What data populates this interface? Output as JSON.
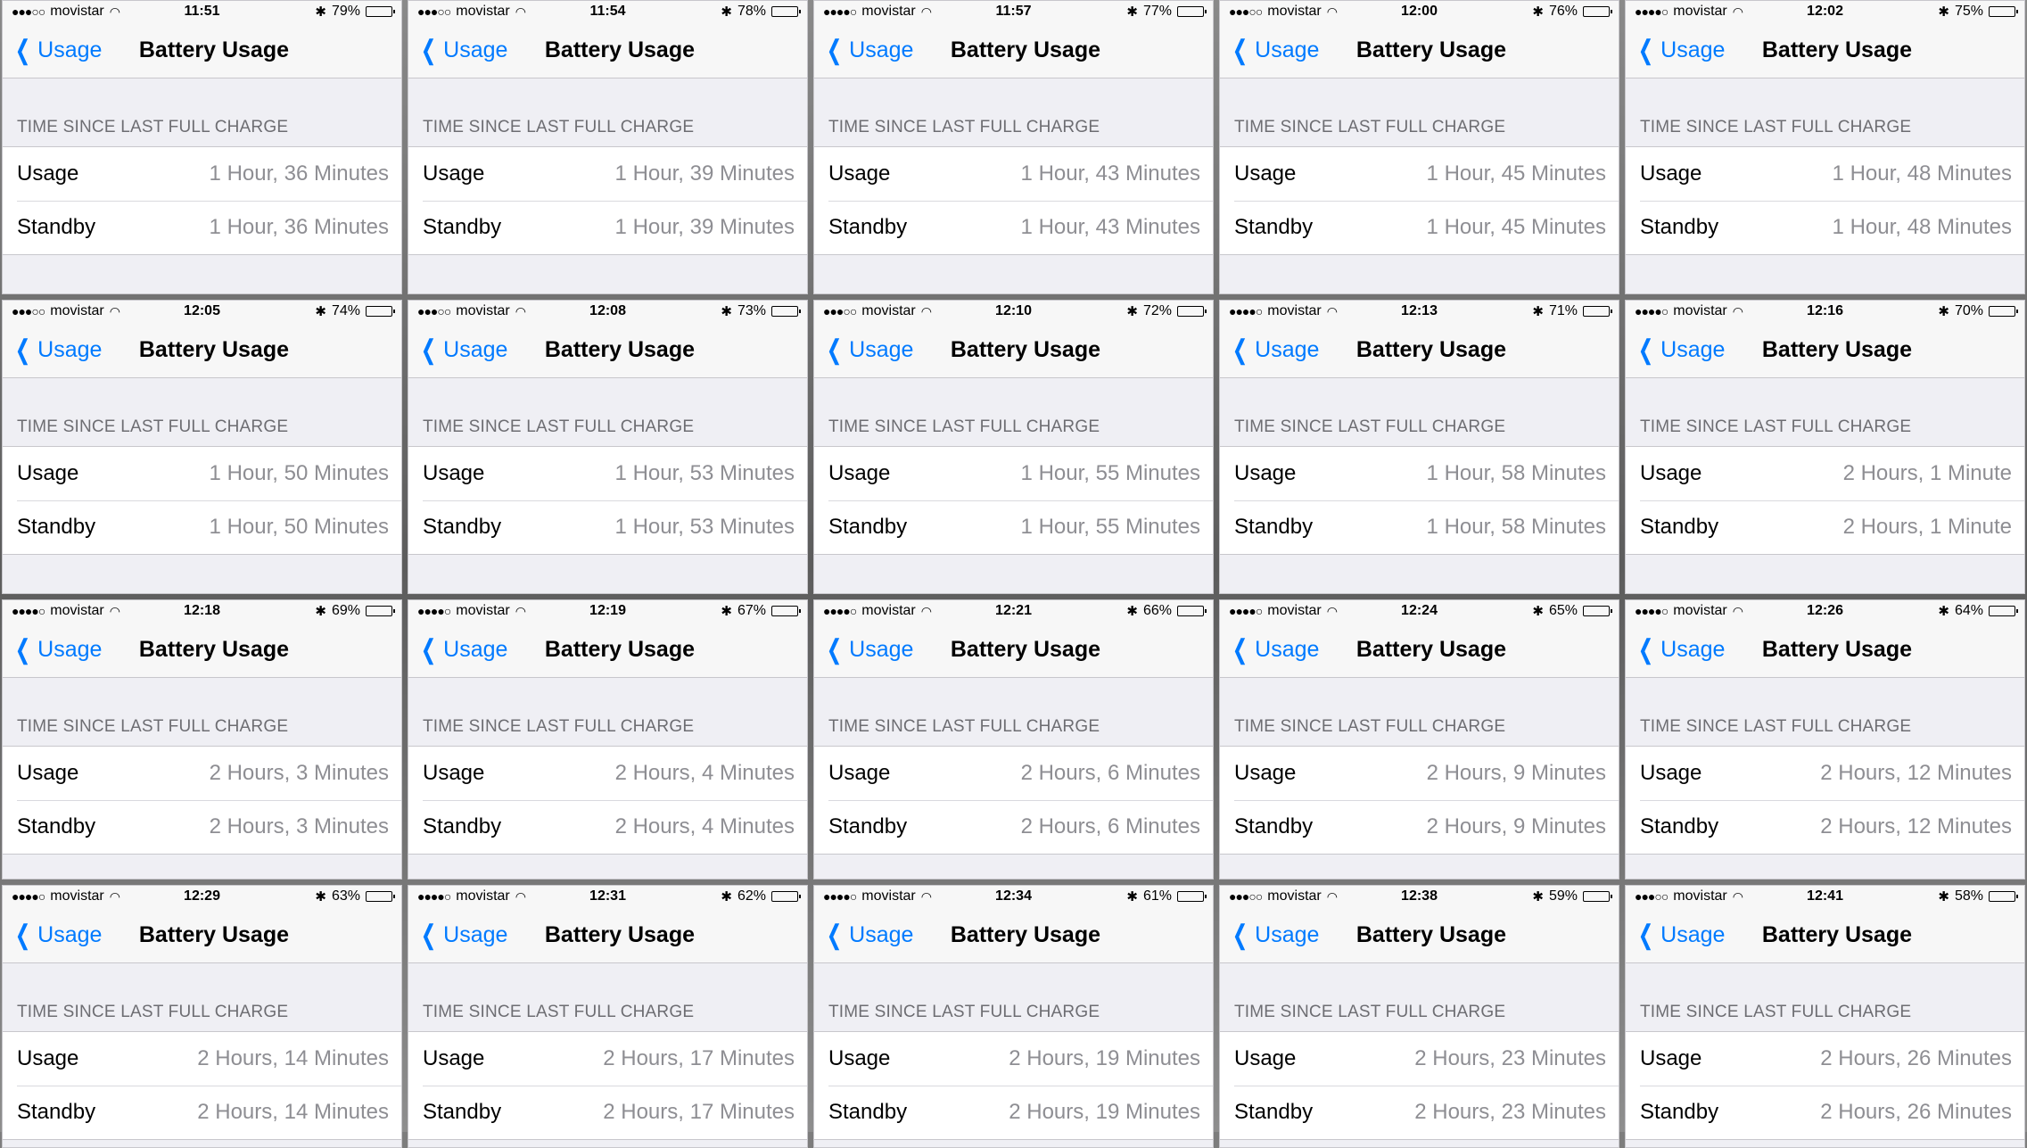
{
  "screens": [
    {
      "carrier": "movistar",
      "signal": "●●●○○",
      "time": "11:51",
      "battery_pct": "79%",
      "battery_level": 0.79,
      "back_label": "Usage",
      "title": "Battery Usage",
      "section_header": "TIME SINCE LAST FULL CHARGE",
      "usage_label": "Usage",
      "usage_value": "1 Hour, 36 Minutes",
      "standby_label": "Standby",
      "standby_value": "1 Hour, 36 Minutes"
    },
    {
      "carrier": "movistar",
      "signal": "●●●○○",
      "time": "11:54",
      "battery_pct": "78%",
      "battery_level": 0.78,
      "back_label": "Usage",
      "title": "Battery Usage",
      "section_header": "TIME SINCE LAST FULL CHARGE",
      "usage_label": "Usage",
      "usage_value": "1 Hour, 39 Minutes",
      "standby_label": "Standby",
      "standby_value": "1 Hour, 39 Minutes"
    },
    {
      "carrier": "movistar",
      "signal": "●●●●○",
      "time": "11:57",
      "battery_pct": "77%",
      "battery_level": 0.77,
      "back_label": "Usage",
      "title": "Battery Usage",
      "section_header": "TIME SINCE LAST FULL CHARGE",
      "usage_label": "Usage",
      "usage_value": "1 Hour, 43 Minutes",
      "standby_label": "Standby",
      "standby_value": "1 Hour, 43 Minutes"
    },
    {
      "carrier": "movistar",
      "signal": "●●●○○",
      "time": "12:00",
      "battery_pct": "76%",
      "battery_level": 0.76,
      "back_label": "Usage",
      "title": "Battery Usage",
      "section_header": "TIME SINCE LAST FULL CHARGE",
      "usage_label": "Usage",
      "usage_value": "1 Hour, 45 Minutes",
      "standby_label": "Standby",
      "standby_value": "1 Hour, 45 Minutes"
    },
    {
      "carrier": "movistar",
      "signal": "●●●●○",
      "time": "12:02",
      "battery_pct": "75%",
      "battery_level": 0.75,
      "back_label": "Usage",
      "title": "Battery Usage",
      "section_header": "TIME SINCE LAST FULL CHARGE",
      "usage_label": "Usage",
      "usage_value": "1 Hour, 48 Minutes",
      "standby_label": "Standby",
      "standby_value": "1 Hour, 48 Minutes"
    },
    {
      "carrier": "movistar",
      "signal": "●●●○○",
      "time": "12:05",
      "battery_pct": "74%",
      "battery_level": 0.74,
      "back_label": "Usage",
      "title": "Battery Usage",
      "section_header": "TIME SINCE LAST FULL CHARGE",
      "usage_label": "Usage",
      "usage_value": "1 Hour, 50 Minutes",
      "standby_label": "Standby",
      "standby_value": "1 Hour, 50 Minutes"
    },
    {
      "carrier": "movistar",
      "signal": "●●●○○",
      "time": "12:08",
      "battery_pct": "73%",
      "battery_level": 0.73,
      "back_label": "Usage",
      "title": "Battery Usage",
      "section_header": "TIME SINCE LAST FULL CHARGE",
      "usage_label": "Usage",
      "usage_value": "1 Hour, 53 Minutes",
      "standby_label": "Standby",
      "standby_value": "1 Hour, 53 Minutes"
    },
    {
      "carrier": "movistar",
      "signal": "●●●○○",
      "time": "12:10",
      "battery_pct": "72%",
      "battery_level": 0.72,
      "back_label": "Usage",
      "title": "Battery Usage",
      "section_header": "TIME SINCE LAST FULL CHARGE",
      "usage_label": "Usage",
      "usage_value": "1 Hour, 55 Minutes",
      "standby_label": "Standby",
      "standby_value": "1 Hour, 55 Minutes"
    },
    {
      "carrier": "movistar",
      "signal": "●●●●○",
      "time": "12:13",
      "battery_pct": "71%",
      "battery_level": 0.71,
      "back_label": "Usage",
      "title": "Battery Usage",
      "section_header": "TIME SINCE LAST FULL CHARGE",
      "usage_label": "Usage",
      "usage_value": "1 Hour, 58 Minutes",
      "standby_label": "Standby",
      "standby_value": "1 Hour, 58 Minutes"
    },
    {
      "carrier": "movistar",
      "signal": "●●●●○",
      "time": "12:16",
      "battery_pct": "70%",
      "battery_level": 0.7,
      "back_label": "Usage",
      "title": "Battery Usage",
      "section_header": "TIME SINCE LAST FULL CHARGE",
      "usage_label": "Usage",
      "usage_value": "2 Hours, 1 Minute",
      "standby_label": "Standby",
      "standby_value": "2 Hours, 1 Minute"
    },
    {
      "carrier": "movistar",
      "signal": "●●●●○",
      "time": "12:18",
      "battery_pct": "69%",
      "battery_level": 0.69,
      "back_label": "Usage",
      "title": "Battery Usage",
      "section_header": "TIME SINCE LAST FULL CHARGE",
      "usage_label": "Usage",
      "usage_value": "2 Hours, 3 Minutes",
      "standby_label": "Standby",
      "standby_value": "2 Hours, 3 Minutes"
    },
    {
      "carrier": "movistar",
      "signal": "●●●●○",
      "time": "12:19",
      "battery_pct": "67%",
      "battery_level": 0.67,
      "back_label": "Usage",
      "title": "Battery Usage",
      "section_header": "TIME SINCE LAST FULL CHARGE",
      "usage_label": "Usage",
      "usage_value": "2 Hours, 4 Minutes",
      "standby_label": "Standby",
      "standby_value": "2 Hours, 4 Minutes"
    },
    {
      "carrier": "movistar",
      "signal": "●●●●○",
      "time": "12:21",
      "battery_pct": "66%",
      "battery_level": 0.66,
      "back_label": "Usage",
      "title": "Battery Usage",
      "section_header": "TIME SINCE LAST FULL CHARGE",
      "usage_label": "Usage",
      "usage_value": "2 Hours, 6 Minutes",
      "standby_label": "Standby",
      "standby_value": "2 Hours, 6 Minutes"
    },
    {
      "carrier": "movistar",
      "signal": "●●●●○",
      "time": "12:24",
      "battery_pct": "65%",
      "battery_level": 0.65,
      "back_label": "Usage",
      "title": "Battery Usage",
      "section_header": "TIME SINCE LAST FULL CHARGE",
      "usage_label": "Usage",
      "usage_value": "2 Hours, 9 Minutes",
      "standby_label": "Standby",
      "standby_value": "2 Hours, 9 Minutes"
    },
    {
      "carrier": "movistar",
      "signal": "●●●●○",
      "time": "12:26",
      "battery_pct": "64%",
      "battery_level": 0.64,
      "back_label": "Usage",
      "title": "Battery Usage",
      "section_header": "TIME SINCE LAST FULL CHARGE",
      "usage_label": "Usage",
      "usage_value": "2 Hours, 12 Minutes",
      "standby_label": "Standby",
      "standby_value": "2 Hours, 12 Minutes"
    },
    {
      "carrier": "movistar",
      "signal": "●●●●○",
      "time": "12:29",
      "battery_pct": "63%",
      "battery_level": 0.63,
      "back_label": "Usage",
      "title": "Battery Usage",
      "section_header": "TIME SINCE LAST FULL CHARGE",
      "usage_label": "Usage",
      "usage_value": "2 Hours, 14 Minutes",
      "standby_label": "Standby",
      "standby_value": "2 Hours, 14 Minutes"
    },
    {
      "carrier": "movistar",
      "signal": "●●●●○",
      "time": "12:31",
      "battery_pct": "62%",
      "battery_level": 0.62,
      "back_label": "Usage",
      "title": "Battery Usage",
      "section_header": "TIME SINCE LAST FULL CHARGE",
      "usage_label": "Usage",
      "usage_value": "2 Hours, 17 Minutes",
      "standby_label": "Standby",
      "standby_value": "2 Hours, 17 Minutes"
    },
    {
      "carrier": "movistar",
      "signal": "●●●●○",
      "time": "12:34",
      "battery_pct": "61%",
      "battery_level": 0.61,
      "back_label": "Usage",
      "title": "Battery Usage",
      "section_header": "TIME SINCE LAST FULL CHARGE",
      "usage_label": "Usage",
      "usage_value": "2 Hours, 19 Minutes",
      "standby_label": "Standby",
      "standby_value": "2 Hours, 19 Minutes"
    },
    {
      "carrier": "movistar",
      "signal": "●●●○○",
      "time": "12:38",
      "battery_pct": "59%",
      "battery_level": 0.59,
      "back_label": "Usage",
      "title": "Battery Usage",
      "section_header": "TIME SINCE LAST FULL CHARGE",
      "usage_label": "Usage",
      "usage_value": "2 Hours, 23 Minutes",
      "standby_label": "Standby",
      "standby_value": "2 Hours, 23 Minutes"
    },
    {
      "carrier": "movistar",
      "signal": "●●●○○",
      "time": "12:41",
      "battery_pct": "58%",
      "battery_level": 0.58,
      "back_label": "Usage",
      "title": "Battery Usage",
      "section_header": "TIME SINCE LAST FULL CHARGE",
      "usage_label": "Usage",
      "usage_value": "2 Hours, 26 Minutes",
      "standby_label": "Standby",
      "standby_value": "2 Hours, 26 Minutes"
    }
  ],
  "colors": {
    "accent": "#007aff",
    "secondary_text": "#8e8e93",
    "header_text": "#6d6d72",
    "background": "#efeff4"
  }
}
